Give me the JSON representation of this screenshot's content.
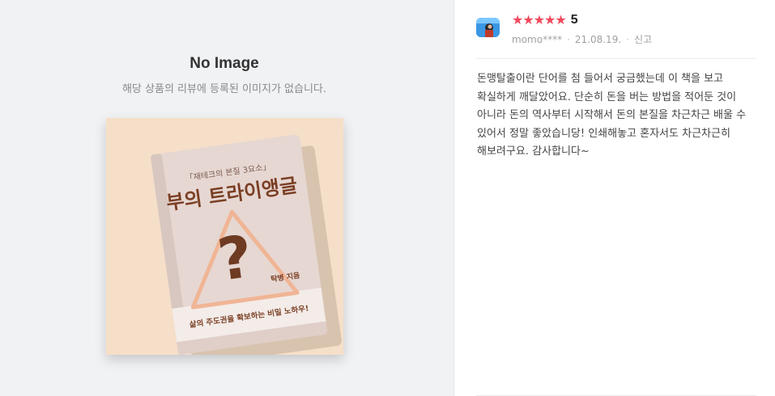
{
  "media": {
    "no_image_title": "No Image",
    "no_image_subtitle": "해당 상품의 리뷰에 등록된 이미지가 없습니다.",
    "book_cover": {
      "tagline": "「재테크의 본질 3요소」",
      "title": "부의 트라이앵글",
      "author": "탁병 지음",
      "subtitle": "삶의 주도권을 확보하는 비밀 노하우!"
    }
  },
  "review": {
    "rating": "5",
    "stars_count": 5,
    "star_color": "#f04a5c",
    "author": "momo****",
    "date": "21.08.19.",
    "report_label": "신고",
    "body": "돈맹탈출이란 단어를 첨 들어서 궁금했는데 이 책을 보고 확실하게 깨달았어요. 단순히 돈을 버는 방법을 적어둔 것이 아니라 돈의 역사부터 시작해서 돈의 본질을 차근차근 배울 수 있어서 정말 좋았습니당! 인쇄해놓고 혼자서도 차근차근히 해보려구요. 감사합니다~"
  }
}
